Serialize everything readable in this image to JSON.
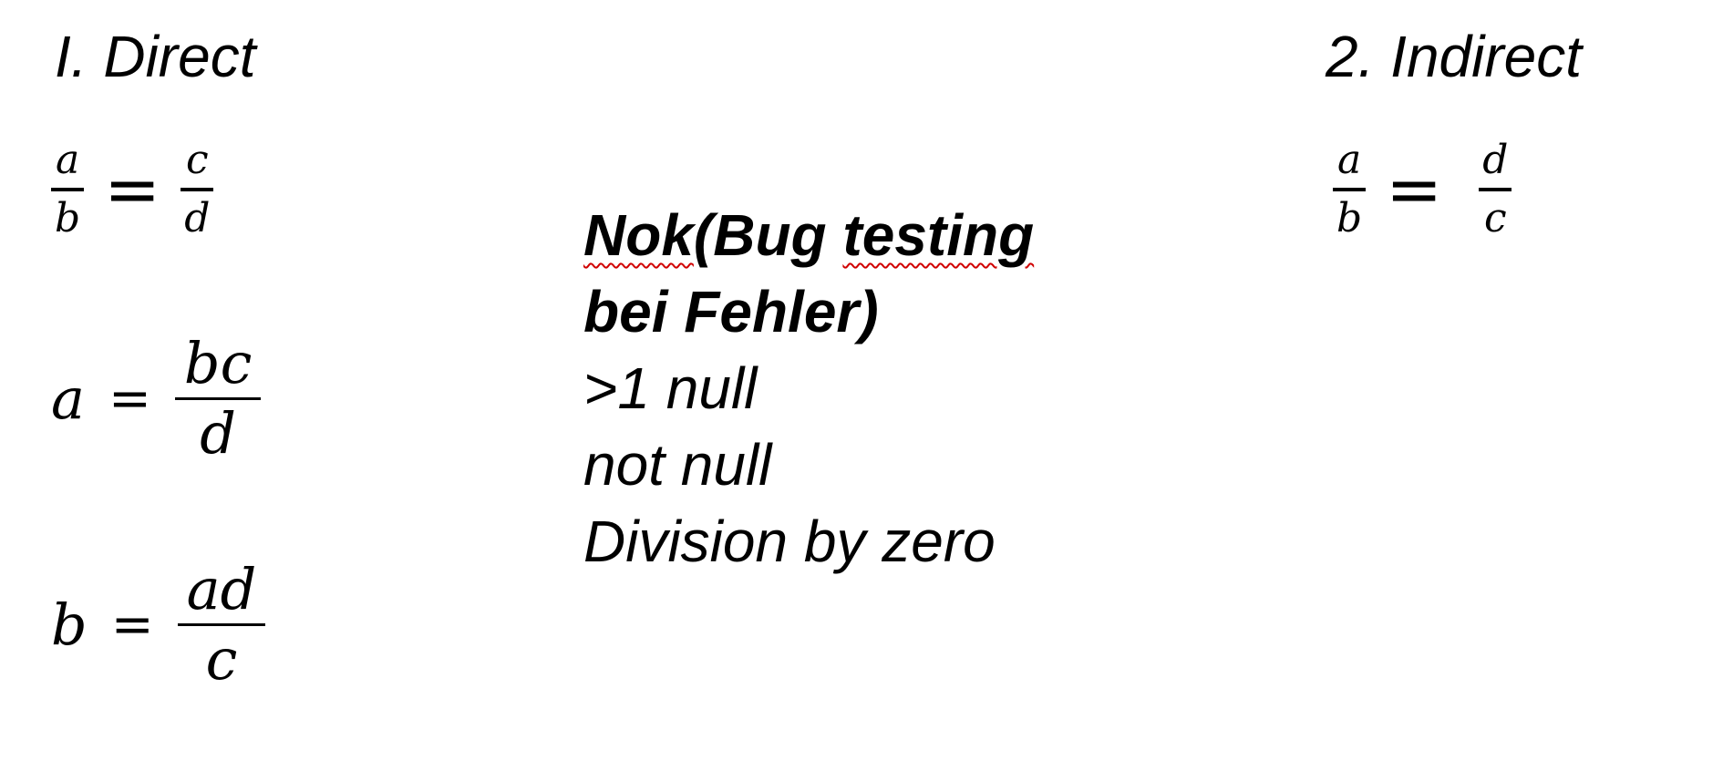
{
  "direct": {
    "heading": "I. Direct",
    "eq1": {
      "a": "a",
      "b": "b",
      "op": "=",
      "c": "c",
      "d": "d"
    },
    "eq2": {
      "lhs": "a",
      "op": "=",
      "num": "bc",
      "den": "d"
    },
    "eq3": {
      "lhs": "b",
      "op": "=",
      "num": "ad",
      "den": "c"
    }
  },
  "indirect": {
    "heading": "2. Indirect",
    "eq1": {
      "a": "a",
      "b": "b",
      "op": "=",
      "num": "d",
      "den": "c"
    }
  },
  "note": {
    "word1": "Nok",
    "word1_rest": "(Bug ",
    "word2": "testing",
    "line2": "bei Fehler)",
    "line3": ">1 null",
    "line4": "not null",
    "line5": "Division by zero"
  },
  "colors": {
    "spellcheck_underline": "#d00000"
  }
}
